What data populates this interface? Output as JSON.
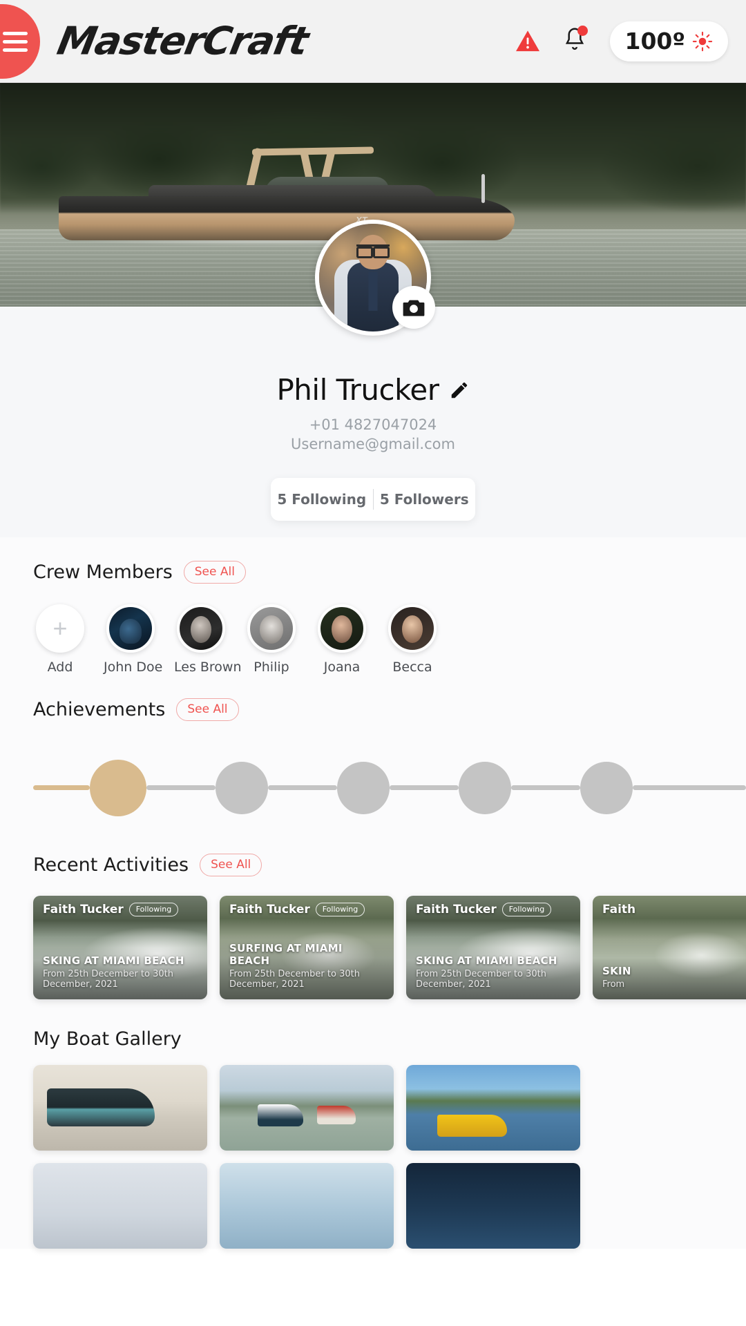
{
  "header": {
    "menu_icon": "hamburger-menu-icon",
    "brand": "MasterCraft",
    "warning_icon": "warning-triangle-icon",
    "notification_icon": "bell-icon",
    "temperature": "100º",
    "weather_icon": "sun-icon",
    "accent_color": "#ef5350"
  },
  "hero": {
    "image_alt": "mastercraft-boat-on-lake",
    "boat_logo": "XT"
  },
  "profile": {
    "avatar_alt": "profile-photo",
    "camera_icon": "camera-icon",
    "name": "Phil Trucker",
    "edit_icon": "pencil-edit-icon",
    "phone": "+01 4827047024",
    "email": "Username@gmail.com",
    "following": "5 Following",
    "followers": "5 Followers"
  },
  "crew": {
    "title": "Crew Members",
    "see_all": "See All",
    "items": [
      {
        "label": "Add",
        "type": "add",
        "avatar_class": "crew-add"
      },
      {
        "label": "John Doe",
        "type": "member",
        "avatar_class": "a-john"
      },
      {
        "label": "Les Brown",
        "type": "member",
        "avatar_class": "a-les"
      },
      {
        "label": "Philip",
        "type": "member",
        "avatar_class": "a-philip"
      },
      {
        "label": "Joana",
        "type": "member",
        "avatar_class": "a-joana"
      },
      {
        "label": "Becca",
        "type": "member",
        "avatar_class": "a-becca"
      }
    ]
  },
  "achievements": {
    "title": "Achievements",
    "see_all": "See All",
    "completed_color": "#d9bb8e",
    "pending_color": "#c4c4c4",
    "steps": [
      {
        "state": "completed",
        "size": 82
      },
      {
        "state": "pending",
        "size": 76
      },
      {
        "state": "pending",
        "size": 76
      },
      {
        "state": "pending",
        "size": 76
      },
      {
        "state": "pending",
        "size": 76
      }
    ]
  },
  "recent_activities": {
    "title": "Recent Activities",
    "see_all": "See All",
    "cards": [
      {
        "user": "Faith Tucker",
        "badge": "Following",
        "title": "SKING AT MIAMI BEACH",
        "subtitle": "From 25th December to 30th December, 2021",
        "image_class": "img-ski"
      },
      {
        "user": "Faith Tucker",
        "badge": "Following",
        "title": "SURFING AT MIAMI BEACH",
        "subtitle": "From 25th December to 30th December, 2021",
        "image_class": "img-surf"
      },
      {
        "user": "Faith Tucker",
        "badge": "Following",
        "title": "SKING AT MIAMI BEACH",
        "subtitle": "From 25th December to 30th December, 2021",
        "image_class": "img-ski"
      },
      {
        "user": "Faith",
        "badge": "",
        "title": "SKIN",
        "subtitle": "From",
        "image_class": "img-surf"
      }
    ]
  },
  "gallery": {
    "title": "My Boat Gallery",
    "items": [
      {
        "alt": "boat-on-lake-sunset",
        "image_class": "g1"
      },
      {
        "alt": "two-boats-on-river",
        "image_class": "g2"
      },
      {
        "alt": "yellow-boat-at-marina",
        "image_class": "g3"
      },
      {
        "alt": "boat-gallery-4",
        "image_class": "g4"
      },
      {
        "alt": "boat-gallery-5",
        "image_class": "g5"
      },
      {
        "alt": "boat-gallery-6",
        "image_class": "g6"
      }
    ]
  }
}
